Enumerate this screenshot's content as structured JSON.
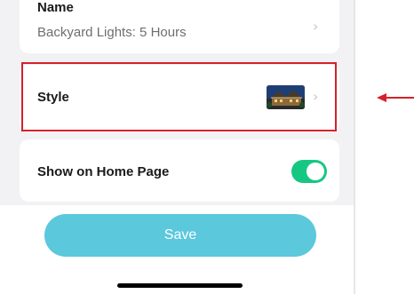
{
  "name_row": {
    "label": "Name",
    "value": "Backyard Lights: 5 Hours"
  },
  "style_row": {
    "label": "Style"
  },
  "home_row": {
    "label": "Show on Home Page",
    "toggle_on": true
  },
  "save_button": {
    "label": "Save"
  },
  "colors": {
    "accent_toggle": "#16c784",
    "save_button": "#5bc8dc",
    "highlight": "#d6202a",
    "arrow": "#d6202a"
  }
}
